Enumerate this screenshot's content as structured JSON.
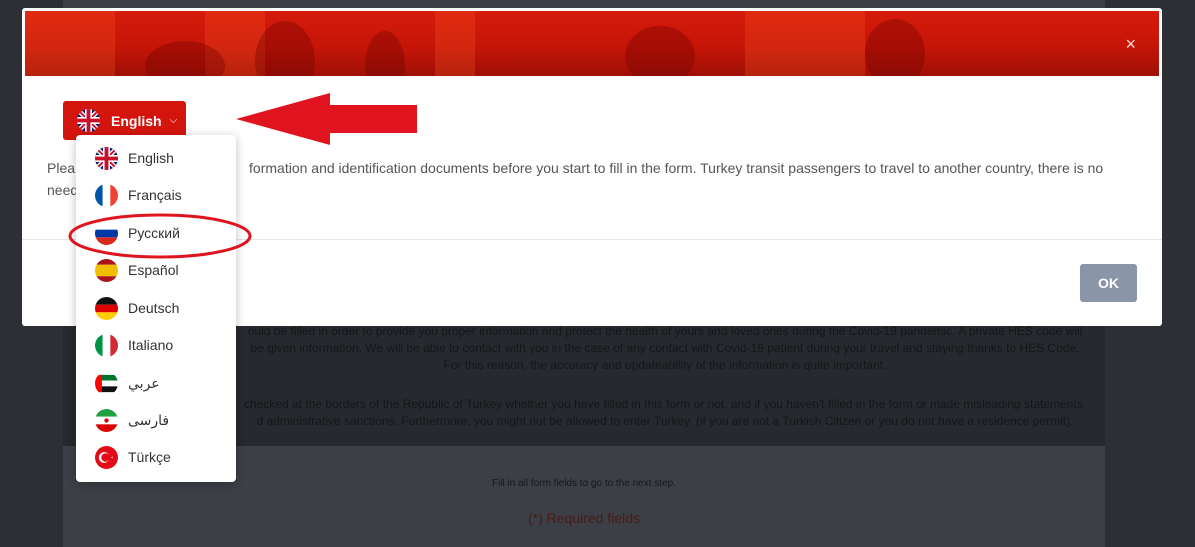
{
  "background": {
    "paragraph1": "ould be filled in order to provide you proper information and protect the health of yours and loved ones during the Covid-19 pandemic. A private HES code will be given information. We will be able to contact with you in the case of any contact with Covid-19 patient during your travel and staying thanks to HES Code. For this reason, the accuracy and updateability of the information is quite important.",
    "paragraph2": "checked at the borders of the Republic of Turkey whether you have filled in this form or not, and if you haven't filled in the form or made misleading statements, d administrative sanctions. Furthermore, you might not be allowed to enter Turkey. (if you are not a Turkish Citizen or you do not have a residence permit).",
    "fill_hint": "Fill in all form fields to go to the next step.",
    "required_note": "(*) Required fields"
  },
  "modal": {
    "close_glyph": "×",
    "language_button_label": "English",
    "language_button_chevron": "⌵",
    "text_line1_left": "Plea",
    "text_line1_right": "formation and identification documents before you start to fill in the form. Turkey transit passengers to travel to another country, there is no",
    "text_line2_left": "need",
    "ok_label": "OK"
  },
  "languages": [
    {
      "label": "English",
      "flag": "uk-flag-icon"
    },
    {
      "label": "Français",
      "flag": "france-flag-icon"
    },
    {
      "label": "Русский",
      "flag": "russia-flag-icon"
    },
    {
      "label": "Español",
      "flag": "spain-flag-icon"
    },
    {
      "label": "Deutsch",
      "flag": "germany-flag-icon"
    },
    {
      "label": "Italiano",
      "flag": "italy-flag-icon"
    },
    {
      "label": "عربي",
      "flag": "uae-flag-icon"
    },
    {
      "label": "فارسی",
      "flag": "iran-flag-icon"
    },
    {
      "label": "Türkçe",
      "flag": "turkey-flag-icon"
    }
  ],
  "colors": {
    "brand_red": "#d4150e",
    "ok_button": "#8a96a8",
    "annotation_red": "#e0141e"
  }
}
